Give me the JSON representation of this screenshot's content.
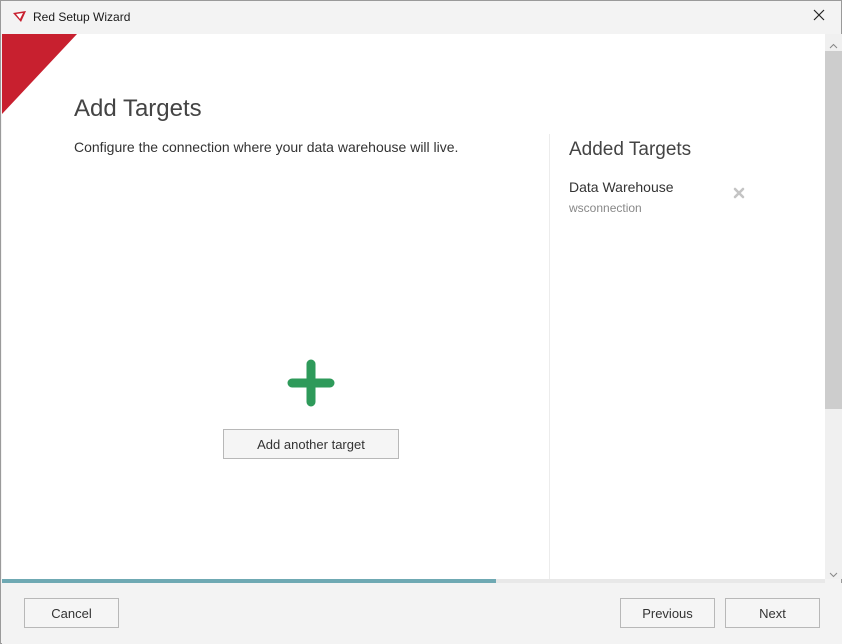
{
  "window": {
    "title": "Red Setup Wizard"
  },
  "icons": {
    "app": "red-app-icon",
    "close": "close-icon",
    "remove": "remove-x-icon",
    "add": "green-plus-icon",
    "scroll_up": "chevron-up-icon",
    "scroll_down": "chevron-down-icon"
  },
  "colors": {
    "brand_red": "#c8202f",
    "plus_green": "#2e9a5a",
    "progress_teal": "#6fa9b3"
  },
  "page": {
    "title": "Add Targets",
    "subtitle": "Configure the connection where your data warehouse will live.",
    "add_button_label": "Add another target"
  },
  "added_targets": {
    "heading": "Added Targets",
    "items": [
      {
        "name": "Data Warehouse",
        "connection": "wsconnection"
      }
    ]
  },
  "progress": {
    "fraction": 0.6
  },
  "footer": {
    "cancel_label": "Cancel",
    "previous_label": "Previous",
    "next_label": "Next"
  }
}
